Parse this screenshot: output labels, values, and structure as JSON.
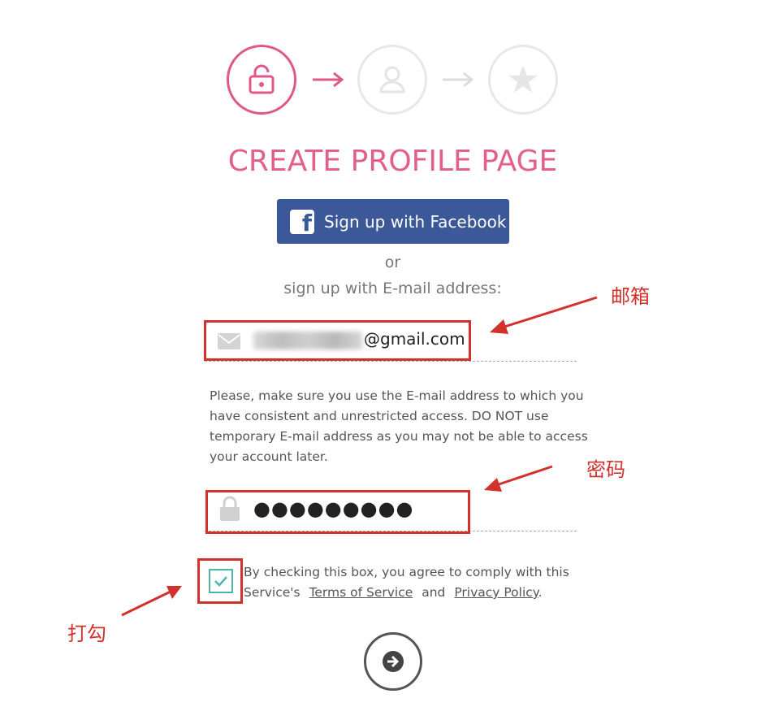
{
  "steps": [
    {
      "icon": "lock-icon",
      "state": "active"
    },
    {
      "icon": "user-icon",
      "state": "inactive"
    },
    {
      "icon": "star-icon",
      "state": "inactive"
    }
  ],
  "title": "CREATE PROFILE PAGE",
  "facebook_button": {
    "icon": "facebook-icon",
    "label": "Sign up with Facebook"
  },
  "or_text": "or",
  "email_prompt": "sign up with E-mail address:",
  "email_field": {
    "icon": "envelope-icon",
    "value": "@gmail.com"
  },
  "notice": "Please, make sure you use the E-mail address to which you have consistent and unrestricted access. DO NOT use temporary E-mail address as you may not be able to access your account later.",
  "password_field": {
    "icon": "lock-icon",
    "value": "●●●●●●●●●"
  },
  "agreement": {
    "checked": true,
    "text_before": "By checking this box, you agree to comply with this Service's",
    "terms_link": "Terms of Service",
    "and_text": "and",
    "privacy_link": "Privacy Policy",
    "end_text": "."
  },
  "next_button": {
    "icon": "arrow-right-icon"
  },
  "annotations": {
    "email_label": "邮箱",
    "password_label": "密码",
    "checkbox_label": "打勾"
  },
  "colors": {
    "accent": "#e35f8d",
    "facebook": "#3b5998",
    "annotation_red": "#d2322b",
    "checkbox_teal": "#4db6ac"
  }
}
